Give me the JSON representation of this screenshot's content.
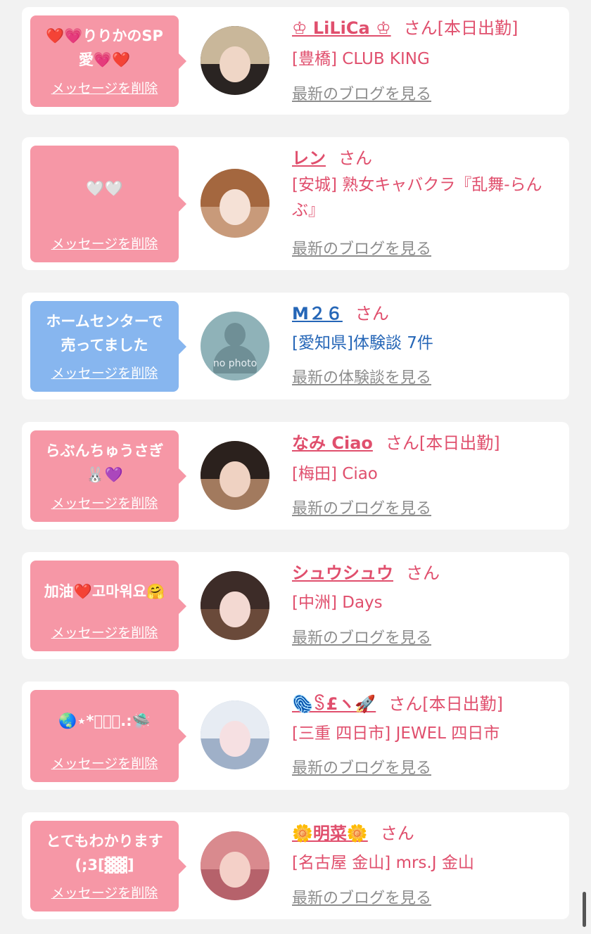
{
  "delete_label": "メッセージを削除",
  "colors": {
    "bubble_pink": "#f697a6",
    "bubble_blue": "#87b6ef",
    "accent_pink": "#e04f6d",
    "accent_blue": "#2566b7",
    "link_gray": "#8d8d8d"
  },
  "messages": [
    {
      "bubble_color": "pink",
      "bubble_text": "❤️💗りりかのSP\n愛💗❤️",
      "name": "♔ LiLiCa ♔",
      "name_color": "pink",
      "san": "さん",
      "status": "[本日出勤]",
      "shop": "[豊橋] CLUB KING",
      "blog_link": "最新のブログを見る",
      "avatar": {
        "hair": "#c9b79a",
        "face": "#efd6c6",
        "bg": "#2a2422"
      }
    },
    {
      "bubble_color": "pink",
      "bubble_text": "🤍🤍",
      "name": "レン",
      "name_color": "pink",
      "san": "さん",
      "status": "",
      "shop": "[安城] 熟女キャバクラ『乱舞-らんぶ』",
      "blog_link": "最新のブログを見る",
      "avatar": {
        "hair": "#a4673f",
        "face": "#f5e1d6",
        "bg": "#c89a7a"
      }
    },
    {
      "bubble_color": "blue",
      "bubble_text": "ホームセンターで\n売ってました",
      "name": "M２６",
      "name_color": "blue",
      "san": "さん",
      "status": "",
      "shop": "[愛知県]体験談 7件",
      "blog_link": "最新の体験談を見る",
      "avatar": {
        "nophoto": "no photo",
        "bg": "#8fb2b8"
      }
    },
    {
      "bubble_color": "pink",
      "bubble_text": "らぶんちゅうさぎ\n🐰💜",
      "name": "なみ Ciao",
      "name_color": "pink",
      "san": "さん",
      "status": "[本日出勤]",
      "shop": "[梅田] Ciao",
      "blog_link": "最新のブログを見る",
      "avatar": {
        "hair": "#2b211d",
        "face": "#efd2c2",
        "bg": "#a27a5e"
      }
    },
    {
      "bubble_color": "pink",
      "bubble_text": "加油❤️고마워요🤗",
      "name": "シュウシュウ",
      "name_color": "pink",
      "san": "さん",
      "status": "",
      "shop": "[中洲] Days",
      "blog_link": "最新のブログを見る",
      "avatar": {
        "hair": "#3d2c28",
        "face": "#f3d9d2",
        "bg": "#6a4a3a"
      }
    },
    {
      "bubble_color": "pink",
      "bubble_text": "🌏⋆*ﾟ･｡.:🛸",
      "name": "🫆ꌗ£ヽ🚀",
      "name_color": "pink",
      "san": "さん",
      "status": "[本日出勤]",
      "shop": "[三重 四日市] JEWEL 四日市",
      "blog_link": "最新のブログを見る",
      "avatar": {
        "hair": "#e7ecf3",
        "face": "#f6e0e2",
        "bg": "#9fb0c8"
      }
    },
    {
      "bubble_color": "pink",
      "bubble_text": "とてもわかります\n(;3[▓▓]",
      "name": "🌼明菜🌼",
      "name_color": "pink",
      "san": "さん",
      "status": "",
      "shop": "[名古屋 金山] mrs.J 金山",
      "blog_link": "最新のブログを見る",
      "avatar": {
        "hair": "#d98a8e",
        "face": "#f4d0c8",
        "bg": "#b6626b"
      }
    }
  ]
}
